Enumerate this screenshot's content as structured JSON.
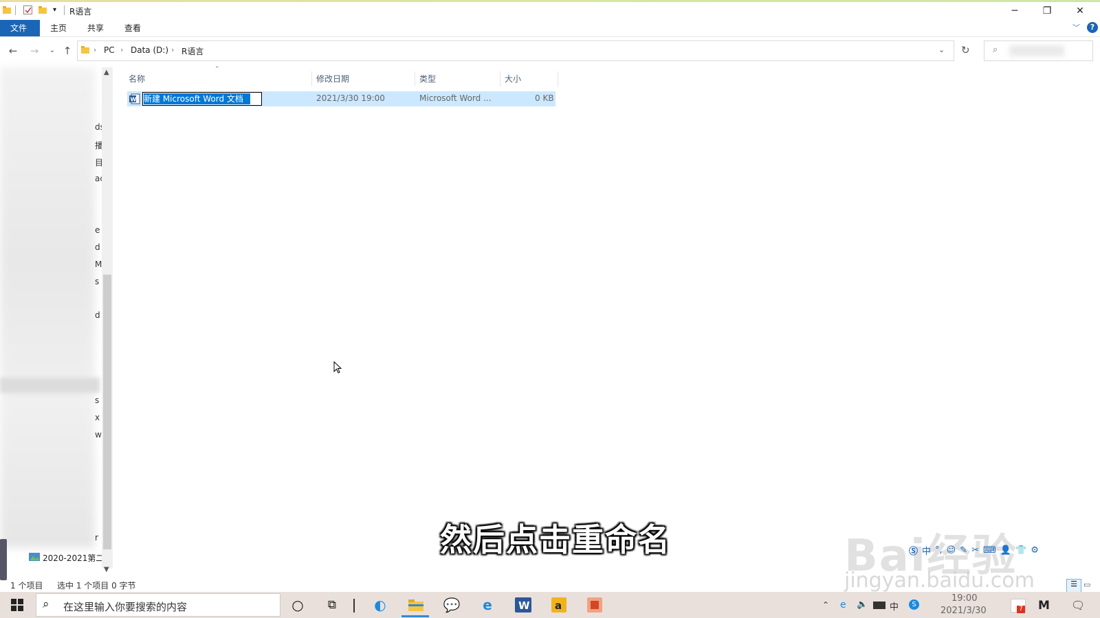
{
  "window": {
    "title": "R语言"
  },
  "ribbon": {
    "tabs": [
      "文件",
      "主页",
      "共享",
      "查看"
    ]
  },
  "address": {
    "crumbs": [
      "PC",
      "Data (D:)",
      "R语言"
    ]
  },
  "nav_fragments": [
    "ds",
    "播",
    "目",
    "ac",
    "e",
    "d",
    "Ma",
    "s",
    "d",
    "s",
    "x",
    "w",
    "r"
  ],
  "nav_folder": "2020-2021第二",
  "columns": {
    "name": "名称",
    "date": "修改日期",
    "type": "类型",
    "size": "大小"
  },
  "file": {
    "name": "新建 Microsoft Word 文档",
    "date": "2021/3/30 19:00",
    "type": "Microsoft Word ...",
    "size": "0 KB"
  },
  "status": {
    "count": "1 个项目",
    "selected": "选中 1 个项目  0 字节"
  },
  "caption": "然后点击重命名",
  "watermark": {
    "brand": "Bai经验",
    "url": "jingyan.baidu.com"
  },
  "taskbar": {
    "search_placeholder": "在这里输入你要搜索的内容",
    "time": "19:00",
    "date": "2021/3/30",
    "notification_badge": "7"
  },
  "ime": {
    "mode": "中"
  },
  "colors": {
    "accent": "#1b65b6",
    "selection": "#cce8ff",
    "highlight": "#0078d7"
  }
}
